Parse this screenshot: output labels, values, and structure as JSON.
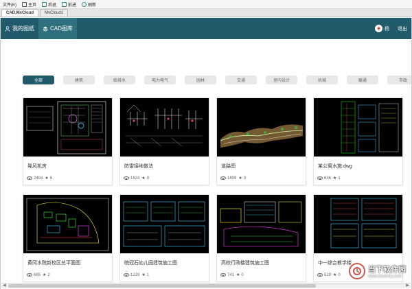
{
  "menubar": {
    "file": "文件(E)",
    "home": "主页",
    "back": "后退",
    "forward": "前进",
    "refresh": "刷新"
  },
  "tabs": [
    "CAD.MxCloud",
    "MxCloud1"
  ],
  "nav": {
    "my_drawings": "我的图纸",
    "cad_library": "CAD图库",
    "user": "杨",
    "logout": "退出"
  },
  "categories": [
    "全部",
    "建筑",
    "给排水",
    "电力电气",
    "园林",
    "交通",
    "室内设计",
    "机械",
    "暖通",
    "市政"
  ],
  "cards": [
    {
      "title": "発风机房",
      "views": "2494",
      "stars": "5"
    },
    {
      "title": "防雷接地做法",
      "views": "1624",
      "stars": "0"
    },
    {
      "title": "道路图",
      "views": "1609",
      "stars": "0"
    },
    {
      "title": "某公寓水施.dwg",
      "views": "636",
      "stars": "1"
    },
    {
      "title": "黄冈水院新校区总平面图",
      "views": "685",
      "stars": "2"
    },
    {
      "title": "皖冠石幼儿园建筑施工图",
      "views": "1219",
      "stars": "1"
    },
    {
      "title": "高校行政楼建筑施工图",
      "views": "741",
      "stars": "0"
    },
    {
      "title": "中一综合教学楼",
      "views": "519",
      "stars": "0"
    }
  ],
  "watermark": {
    "brand": "当下软件园",
    "url": "www.downxia.com"
  },
  "colors": {
    "nav": "#215a6b",
    "accent": "#2f6f7e"
  }
}
